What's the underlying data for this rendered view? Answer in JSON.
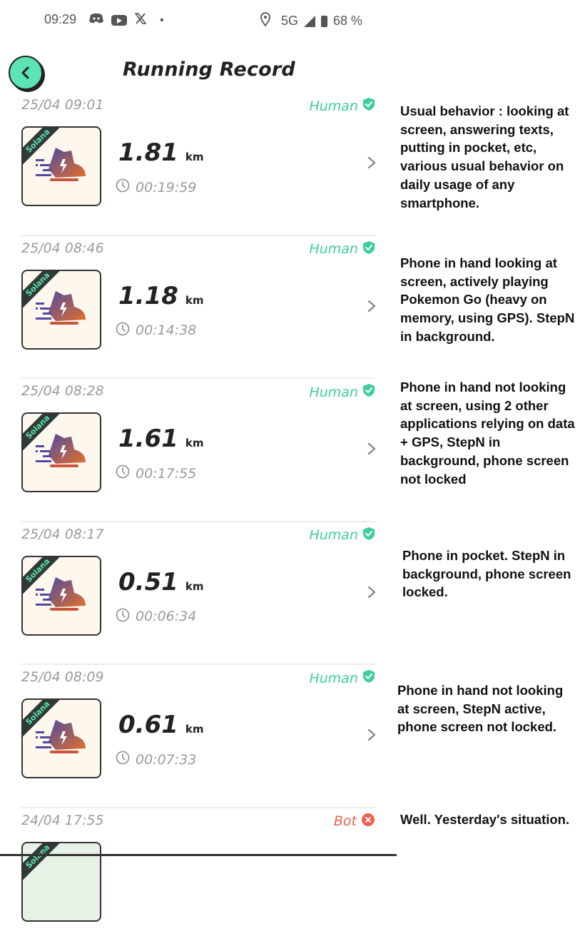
{
  "status_bar": {
    "time": "09:29",
    "left_icons": [
      "discord-icon",
      "youtube-icon",
      "x-icon",
      "dot-icon"
    ],
    "network": "5G",
    "battery": "68 %"
  },
  "header": {
    "title": "Running Record",
    "back_icon": "chevron-left-icon"
  },
  "colors": {
    "accent": "#5de4b3",
    "human": "#3ccf99",
    "bot": "#ef5e4e"
  },
  "records": [
    {
      "date": "25/04 09:01",
      "verdict": "Human",
      "verdict_type": "human",
      "chain": "Solana",
      "distance": "1.81",
      "unit": "km",
      "duration": "00:19:59"
    },
    {
      "date": "25/04 08:46",
      "verdict": "Human",
      "verdict_type": "human",
      "chain": "Solana",
      "distance": "1.18",
      "unit": "km",
      "duration": "00:14:38"
    },
    {
      "date": "25/04 08:28",
      "verdict": "Human",
      "verdict_type": "human",
      "chain": "Solana",
      "distance": "1.61",
      "unit": "km",
      "duration": "00:17:55"
    },
    {
      "date": "25/04 08:17",
      "verdict": "Human",
      "verdict_type": "human",
      "chain": "Solana",
      "distance": "0.51",
      "unit": "km",
      "duration": "00:06:34"
    },
    {
      "date": "25/04 08:09",
      "verdict": "Human",
      "verdict_type": "human",
      "chain": "Solana",
      "distance": "0.61",
      "unit": "km",
      "duration": "00:07:33"
    },
    {
      "date": "24/04 17:55",
      "verdict": "Bot",
      "verdict_type": "bot",
      "chain": "Solana"
    }
  ],
  "annotations": [
    "Usual behavior : looking at screen, answering texts, putting in pocket, etc, various usual behavior on daily usage of any smartphone.",
    "Phone in hand looking at screen, actively playing Pokemon Go (heavy on memory, using GPS). StepN in background.",
    "Phone in hand not looking at screen, using 2 other applications relying on data + GPS, StepN in background, phone screen not locked",
    "Phone in pocket. StepN in background, phone screen locked.",
    "Phone in hand not looking at screen, StepN active, phone screen not locked.",
    "Well. Yesterday's situation."
  ]
}
